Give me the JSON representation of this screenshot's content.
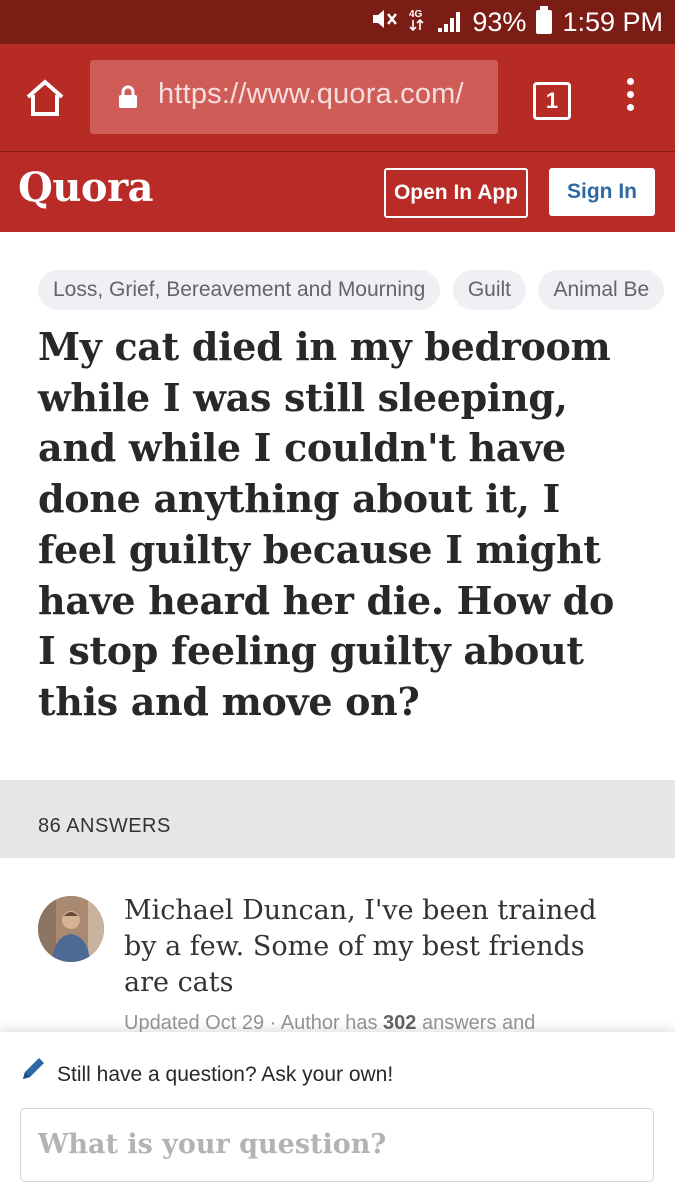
{
  "status_bar": {
    "battery": "93%",
    "time": "1:59 PM",
    "network": "4G",
    "icons": [
      "mute-icon",
      "network-4g-icon",
      "signal-icon",
      "battery-icon"
    ]
  },
  "browser": {
    "url": "https://www.quora.com/",
    "tab_count": "1",
    "icons": [
      "home-icon",
      "lock-icon",
      "tabs-icon",
      "overflow-menu-icon"
    ]
  },
  "header": {
    "logo": "Quora",
    "open_in_app": "Open In App",
    "sign_in": "Sign In"
  },
  "topics": [
    "Loss, Grief, Bereavement and Mourning",
    "Guilt",
    "Animal Be"
  ],
  "question": {
    "title": "My cat died in my bedroom while I was still sleeping, and while I couldn't have done anything about it, I feel guilty because I might have heard her die. How do I stop feeling guilty about this and move on?"
  },
  "answers": {
    "count_label": "86 ANSWERS",
    "first": {
      "author_line": "Michael Duncan, I've been trained by a few. Some of my best friends are cats",
      "updated": "Updated Oct 29 · Author has ",
      "answer_count": "302",
      "answers_suffix": " answers and"
    }
  },
  "ask": {
    "prompt": "Still have a question? Ask your own!",
    "placeholder": "What is your question?"
  },
  "colors": {
    "status_bar": "#7b1c15",
    "browser_bar": "#b72b25",
    "quora_red": "#b92b27",
    "sign_in_text": "#2e69a3",
    "chip_bg": "#eef0f4",
    "answers_bar": "#e6e6e6",
    "pencil": "#2e69a3"
  }
}
